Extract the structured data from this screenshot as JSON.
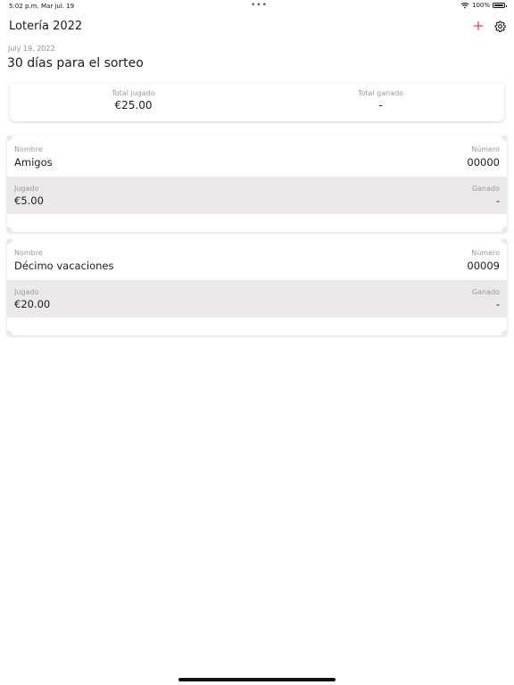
{
  "status_bar": {
    "time": "5:02 p.m.",
    "date": "Mar jul. 19",
    "battery": "100%",
    "icons": [
      "wifi-icon",
      "battery-icon"
    ]
  },
  "nav": {
    "title": "Lotería 2022",
    "add_icon": "plus-icon",
    "settings_icon": "gear-icon",
    "accent_color": "#e0435c"
  },
  "header": {
    "date": "July 19, 2022",
    "countdown": "30 días para el sorteo"
  },
  "summary": {
    "played_label": "Total jugado",
    "played_value": "€25.00",
    "won_label": "Total ganado",
    "won_value": "-"
  },
  "tickets": [
    {
      "name_label": "Nombre",
      "name": "Amigos",
      "number_label": "Número",
      "number": "00000",
      "played_label": "Jugado",
      "played": "€5.00",
      "won_label": "Ganado",
      "won": "-"
    },
    {
      "name_label": "Nombre",
      "name": "Décimo vacaciones",
      "number_label": "Número",
      "number": "00009",
      "played_label": "Jugado",
      "played": "€20.00",
      "won_label": "Ganado",
      "won": "-"
    }
  ]
}
